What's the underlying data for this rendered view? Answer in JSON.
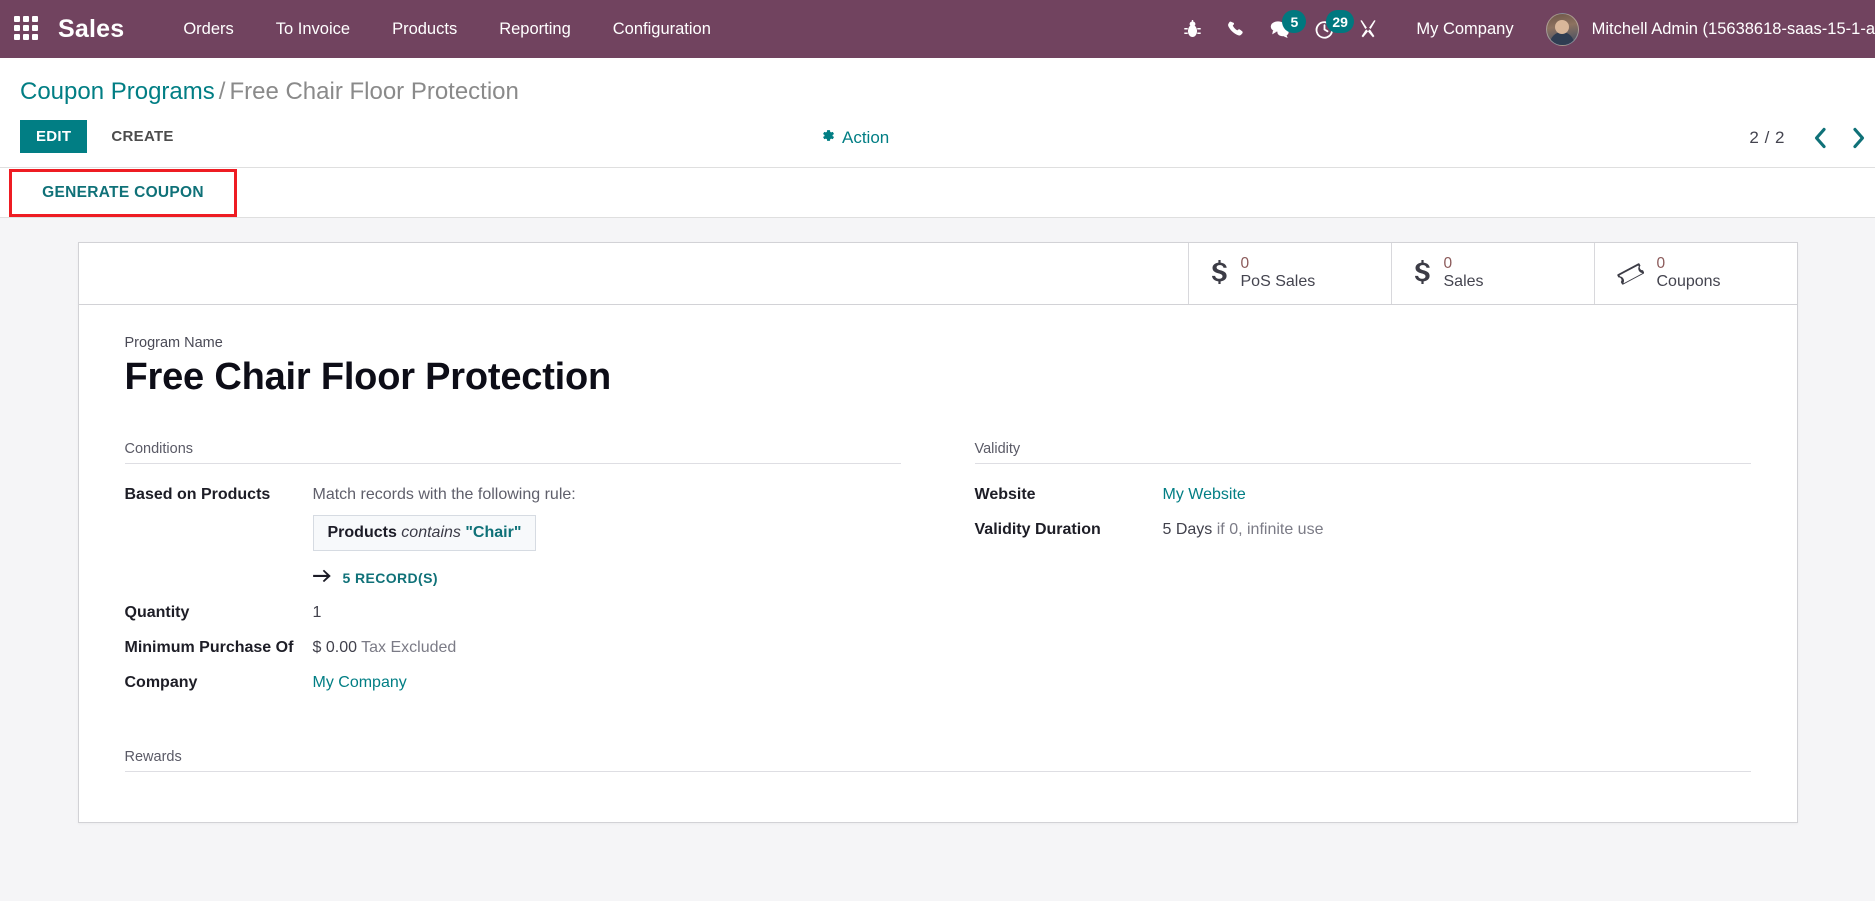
{
  "navbar": {
    "apps_icon": "apps-grid-icon",
    "brand": "Sales",
    "menu": [
      {
        "label": "Orders"
      },
      {
        "label": "To Invoice"
      },
      {
        "label": "Products"
      },
      {
        "label": "Reporting"
      },
      {
        "label": "Configuration"
      }
    ],
    "sys_icons": [
      {
        "name": "bug-icon",
        "badge": null
      },
      {
        "name": "phone-icon",
        "badge": null
      },
      {
        "name": "messages-icon",
        "badge": "5"
      },
      {
        "name": "activities-clock-icon",
        "badge": "29"
      },
      {
        "name": "tools-icon",
        "badge": null
      }
    ],
    "company": "My Company",
    "user": "Mitchell Admin (15638618-saas-15-1-a",
    "avatar": "user-avatar",
    "background_color": "#71435f",
    "badge_color": "#00787f"
  },
  "control_panel": {
    "breadcrumb": {
      "root": "Coupon Programs",
      "separator": "/",
      "current": "Free Chair Floor Protection"
    },
    "edit_label": "EDIT",
    "create_label": "CREATE",
    "action_label": "Action",
    "action_icon": "gear-icon",
    "pager_value": "2 / 2",
    "prev_icon": "chevron-left-icon",
    "next_icon": "chevron-right-icon",
    "generate_coupon_label": "GENERATE COUPON",
    "highlight_color": "#ee1c23",
    "accent_color": "#017e84"
  },
  "form": {
    "stat_buttons": [
      {
        "icon": "dollar-icon",
        "value": "0",
        "label": "PoS Sales"
      },
      {
        "icon": "dollar-icon",
        "value": "0",
        "label": "Sales"
      },
      {
        "icon": "ticket-icon",
        "value": "0",
        "label": "Coupons"
      }
    ],
    "program_name_label": "Program Name",
    "program_name": "Free Chair Floor Protection",
    "conditions": {
      "title": "Conditions",
      "based_on_products_label": "Based on Products",
      "domain_intro": "Match records with the following rule:",
      "domain_field": "Products",
      "domain_operator": "contains",
      "domain_value": "\"Chair\"",
      "records_arrow": "arrow-right-icon",
      "records_count": "5 RECORD(S)",
      "quantity_label": "Quantity",
      "quantity_value": "1",
      "minimum_purchase_label": "Minimum Purchase Of",
      "minimum_purchase_value": "$ 0.00",
      "minimum_purchase_suffix": "Tax Excluded",
      "company_label": "Company",
      "company_value": "My Company"
    },
    "validity": {
      "title": "Validity",
      "website_label": "Website",
      "website_value": "My Website",
      "duration_label": "Validity Duration",
      "duration_value": "5 Days",
      "duration_hint": "if 0, infinite use"
    },
    "rewards": {
      "title": "Rewards"
    }
  }
}
